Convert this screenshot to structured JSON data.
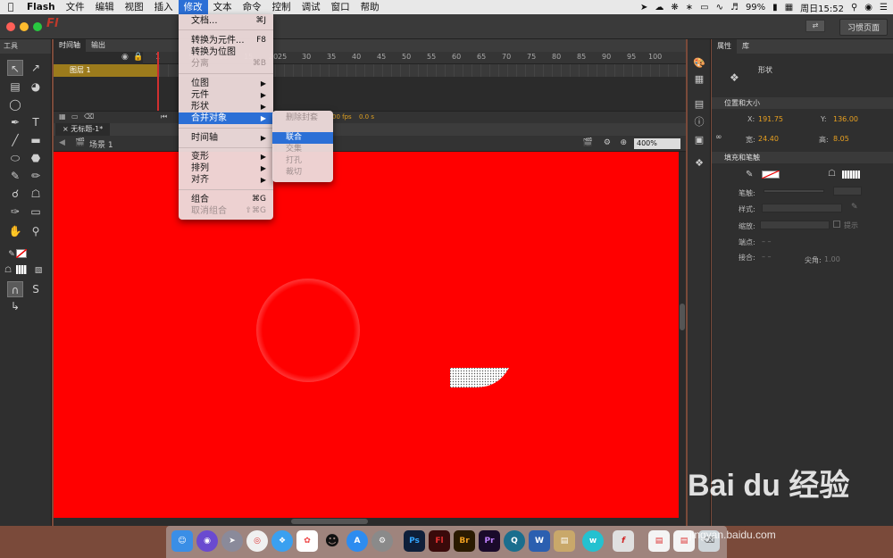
{
  "menubar": {
    "app": "Flash",
    "items": [
      "文件",
      "编辑",
      "视图",
      "插入",
      "修改",
      "文本",
      "命令",
      "控制",
      "调试",
      "窗口",
      "帮助"
    ],
    "active": "修改",
    "battery": "99%",
    "clock": "周日15:52"
  },
  "window": {
    "app_logo": "Fl",
    "workspace": "习惯页面"
  },
  "toolbar": {
    "title": "工具"
  },
  "timeline": {
    "tabs": [
      "时间轴",
      "输出"
    ],
    "ruler": [
      "1",
      "5",
      "10",
      "15",
      "20",
      "25",
      "30",
      "35",
      "40",
      "45",
      "50",
      "55",
      "60",
      "65",
      "70",
      "75",
      "80",
      "85",
      "90",
      "95",
      "100"
    ],
    "layer_name": "图层 1",
    "fps": "00 fps",
    "time": "0.0 s"
  },
  "document": {
    "tab": "无标题-1*",
    "scene": "场景 1",
    "zoom": "400%"
  },
  "properties": {
    "tabs": [
      "属性",
      "库"
    ],
    "type": "形状",
    "pos_section": "位置和大小",
    "x_label": "X:",
    "x_value": "191.75",
    "y_label": "Y:",
    "y_value": "136.00",
    "w_label": "宽:",
    "w_value": "24.40",
    "h_label": "高:",
    "h_value": "8.05",
    "fill_section": "填充和笔触",
    "stroke_label": "笔触:",
    "style_label": "样式:",
    "scale_label": "缩放:",
    "hint_label": "提示",
    "cap_label": "端点:",
    "join_label": "接合:",
    "miter_label": "尖角:",
    "miter_value": "1.00"
  },
  "modify_menu": {
    "items": [
      {
        "label": "文档...",
        "shortcut": "⌘J",
        "disabled": false
      },
      {
        "label": "转换为元件...",
        "shortcut": "F8",
        "disabled": false
      },
      {
        "label": "转换为位图",
        "shortcut": "",
        "disabled": false
      },
      {
        "label": "分离",
        "shortcut": "⌘B",
        "disabled": true
      },
      {
        "label": "位图",
        "shortcut": "▶",
        "disabled": false
      },
      {
        "label": "元件",
        "shortcut": "▶",
        "disabled": false
      },
      {
        "label": "形状",
        "shortcut": "▶",
        "disabled": false
      },
      {
        "label": "合并对象",
        "shortcut": "▶",
        "disabled": false
      },
      {
        "label": "时间轴",
        "shortcut": "▶",
        "disabled": false
      },
      {
        "label": "变形",
        "shortcut": "▶",
        "disabled": false
      },
      {
        "label": "排列",
        "shortcut": "▶",
        "disabled": false
      },
      {
        "label": "对齐",
        "shortcut": "▶",
        "disabled": false
      },
      {
        "label": "组合",
        "shortcut": "⌘G",
        "disabled": false
      },
      {
        "label": "取消组合",
        "shortcut": "⇧⌘G",
        "disabled": true
      }
    ]
  },
  "submenu": {
    "items": [
      {
        "label": "删除封套",
        "disabled": true
      },
      {
        "label": "联合",
        "disabled": false
      },
      {
        "label": "交集",
        "disabled": true
      },
      {
        "label": "打孔",
        "disabled": true
      },
      {
        "label": "裁切",
        "disabled": true
      }
    ]
  },
  "dock": {
    "apps": [
      "Ps",
      "Fl",
      "Br",
      "Pr",
      "W"
    ]
  },
  "watermark": {
    "logo": "Bai du 经验",
    "url": "jingyan.baidu.com"
  },
  "colors": {
    "stage": "#ff0000",
    "highlight": "#2b6fd6",
    "value": "#e8a020"
  }
}
